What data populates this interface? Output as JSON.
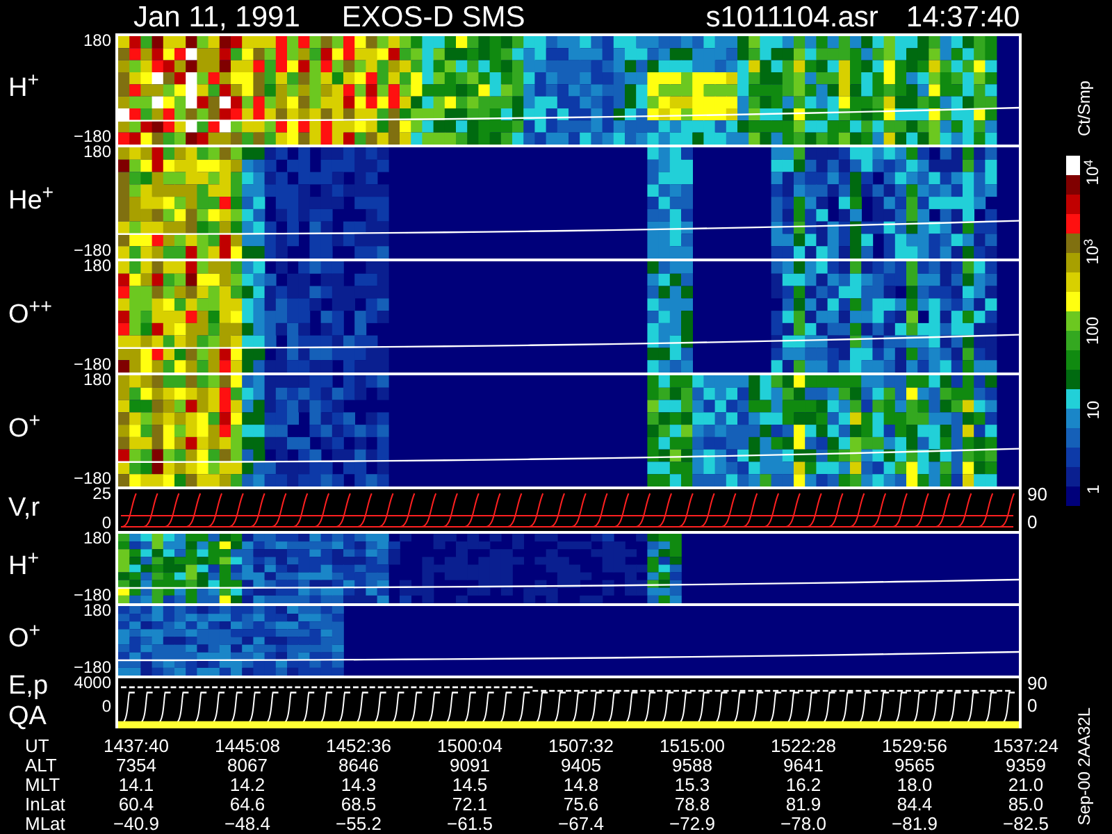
{
  "title": {
    "date": "Jan 11, 1991",
    "instrument": "EXOS-D SMS",
    "file": "s1011104.asr",
    "time": "14:37:40"
  },
  "panels": [
    {
      "kind": "spectrogram",
      "labels": [
        "H$^{+}$"
      ],
      "ticks": [
        "180",
        "−180"
      ]
    },
    {
      "kind": "spectrogram",
      "labels": [
        "He$^{+}$"
      ],
      "ticks": [
        "180",
        "−180"
      ]
    },
    {
      "kind": "spectrogram",
      "labels": [
        "O$^{++}$"
      ],
      "ticks": [
        "180",
        "−180"
      ]
    },
    {
      "kind": "spectrogram",
      "labels": [
        "O$^{+}$"
      ],
      "ticks": [
        "180",
        "−180"
      ]
    },
    {
      "kind": "velocity",
      "labels": [
        "V,r"
      ],
      "ticks": [
        "25",
        "0"
      ],
      "right_ticks": [
        "90",
        "0"
      ]
    },
    {
      "kind": "spectrogram",
      "labels": [
        "H$^{+}$"
      ],
      "ticks": [
        "180",
        "−180"
      ]
    },
    {
      "kind": "spectrogram",
      "labels": [
        "O$^{+}$"
      ],
      "ticks": [
        "180",
        "−180"
      ]
    },
    {
      "kind": "energy",
      "labels": [
        "E,p",
        "QA"
      ],
      "ticks": [
        "4000",
        "0"
      ],
      "right_ticks": [
        "90",
        "0"
      ]
    }
  ],
  "colorbar": {
    "unit": "Ct/Smp",
    "ticks": [
      "10$^{4}$",
      "10$^{3}$",
      "100",
      "10",
      "1"
    ]
  },
  "table": [
    {
      "label": "UT",
      "values": [
        "1437:40",
        "1445:08",
        "1452:36",
        "1500:04",
        "1507:32",
        "1515:00",
        "1522:28",
        "1529:56",
        "1537:24"
      ]
    },
    {
      "label": "ALT",
      "values": [
        "7354",
        "8067",
        "8646",
        "9091",
        "9405",
        "9588",
        "9641",
        "9565",
        "9359"
      ]
    },
    {
      "label": "MLT",
      "values": [
        "14.1",
        "14.2",
        "14.3",
        "14.5",
        "14.8",
        "15.3",
        "16.2",
        "18.0",
        "21.0"
      ]
    },
    {
      "label": "InLat",
      "values": [
        "60.4",
        "64.6",
        "68.5",
        "72.1",
        "75.6",
        "78.8",
        "81.9",
        "84.4",
        "85.0"
      ]
    },
    {
      "label": "MLat",
      "values": [
        "−40.9",
        "−48.4",
        "−55.2",
        "−61.5",
        "−67.4",
        "−72.9",
        "−78.0",
        "−81.9",
        "−82.5"
      ]
    }
  ],
  "footer": "Sep-00 2AA32L"
}
